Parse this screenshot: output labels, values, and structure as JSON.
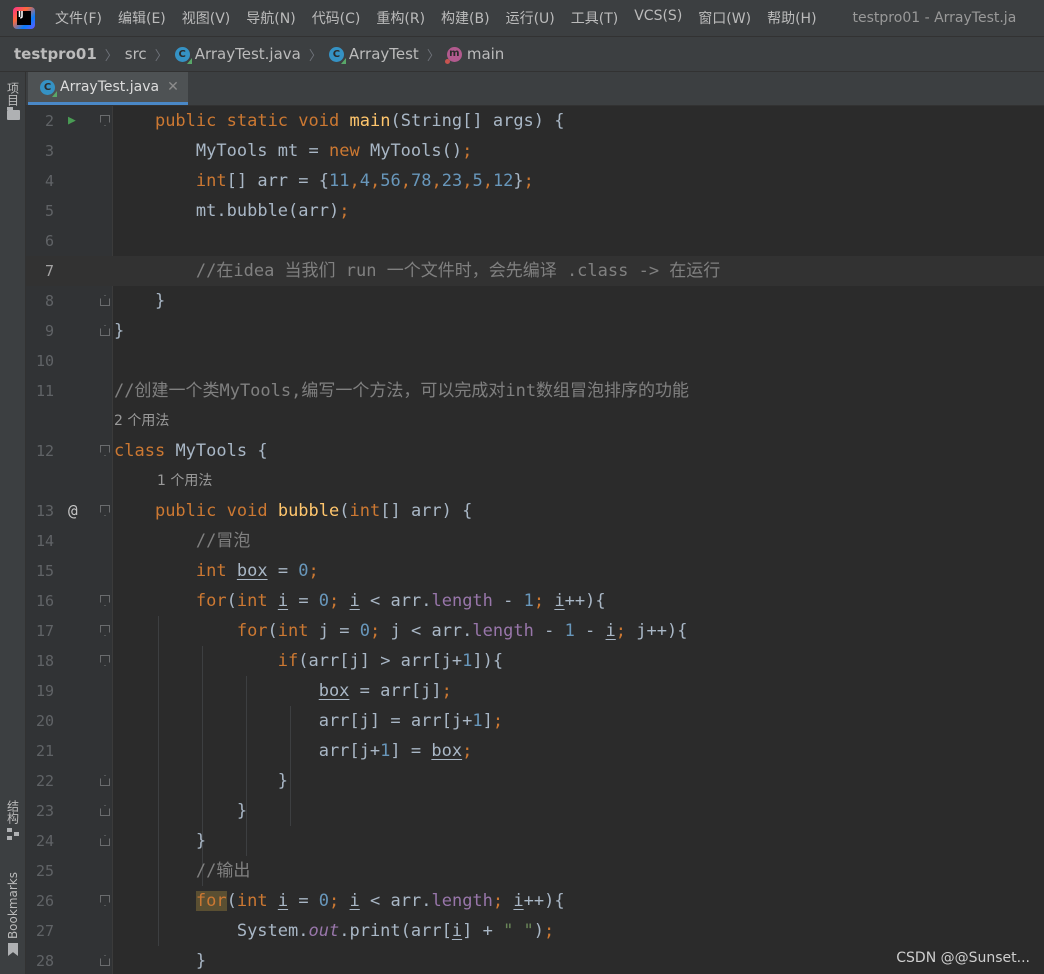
{
  "menubar": {
    "logo_text": "IJ",
    "items": [
      "文件(F)",
      "编辑(E)",
      "视图(V)",
      "导航(N)",
      "代码(C)",
      "重构(R)",
      "构建(B)",
      "运行(U)",
      "工具(T)",
      "VCS(S)",
      "窗口(W)",
      "帮助(H)"
    ],
    "window_title": "testpro01 - ArrayTest.ja"
  },
  "breadcrumb": {
    "project": "testpro01",
    "folder": "src",
    "file": "ArrayTest.java",
    "class": "ArrayTest",
    "method": "main",
    "class_icon_letter": "C",
    "method_icon_letter": "m"
  },
  "tool_strip": {
    "project": "项目",
    "structure": "结构",
    "bookmarks": "Bookmarks"
  },
  "tab": {
    "label": "ArrayTest.java",
    "close": "✕"
  },
  "editor": {
    "lines": [
      {
        "num": "2"
      },
      {
        "num": "3"
      },
      {
        "num": "4"
      },
      {
        "num": "5"
      },
      {
        "num": "6"
      },
      {
        "num": "7"
      },
      {
        "num": "8"
      },
      {
        "num": "9"
      },
      {
        "num": "10"
      },
      {
        "num": "11"
      },
      {
        "num": ""
      },
      {
        "num": "12"
      },
      {
        "num": ""
      },
      {
        "num": "13"
      },
      {
        "num": "14"
      },
      {
        "num": "15"
      },
      {
        "num": "16"
      },
      {
        "num": "17"
      },
      {
        "num": "18"
      },
      {
        "num": "19"
      },
      {
        "num": "20"
      },
      {
        "num": "21"
      },
      {
        "num": "22"
      },
      {
        "num": "23"
      },
      {
        "num": "24"
      },
      {
        "num": "25"
      },
      {
        "num": "26"
      },
      {
        "num": "27"
      },
      {
        "num": "28"
      }
    ],
    "hints": {
      "class_usages": "2 个用法",
      "method_usages": "1 个用法"
    },
    "tokens": {
      "public": "public",
      "static": "static",
      "void": "void",
      "main": "main",
      "String": "String",
      "args": "args",
      "MyTools": "MyTools",
      "mt": "mt",
      "new": "new",
      "int": "int",
      "arr": "arr",
      "bubble": "bubble",
      "class": "class",
      "box": "box",
      "for": "for",
      "if": "if",
      "i": "i",
      "j": "j",
      "length": "length",
      "System": "System",
      "out": "out",
      "print": "print",
      "n0": "0",
      "n1": "1",
      "n11": "11",
      "n4": "4",
      "n56": "56",
      "n78": "78",
      "n23": "23",
      "n5": "5",
      "n12": "12",
      "space_str": "\" \"",
      "comment_line7": "//在idea 当我们 run 一个文件时，会先编译 .class -> 在运行",
      "comment_line11": "//创建一个类MyTools,编写一个方法，可以完成对int数组冒泡排序的功能",
      "comment_bubble": "//冒泡",
      "comment_output": "//输出"
    }
  },
  "watermark": "CSDN @@Sunset..."
}
